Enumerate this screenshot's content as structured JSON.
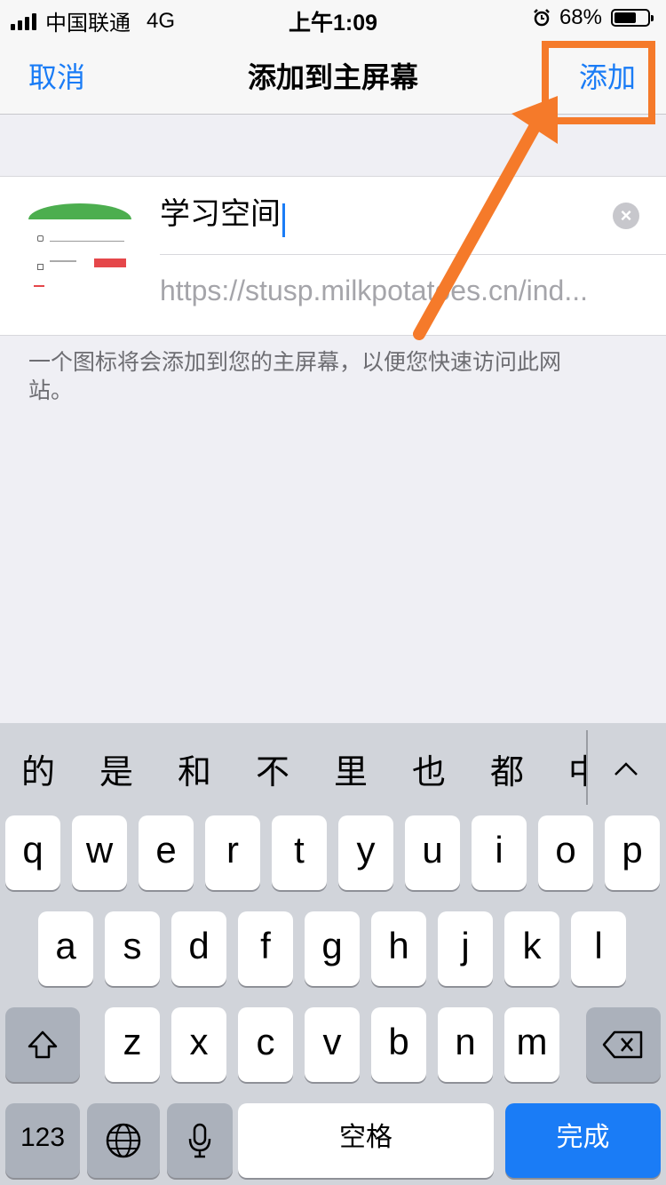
{
  "status_bar": {
    "carrier": "中国联通",
    "network": "4G",
    "time": "上午1:09",
    "battery": "68%",
    "battery_level": 0.68
  },
  "nav": {
    "cancel_label": "取消",
    "title": "添加到主屏幕",
    "add_label": "添加"
  },
  "shortcut": {
    "name_value": "学习空间",
    "url": "https://stusp.milkpotatoes.cn/ind..."
  },
  "hint": "一个图标将会添加到您的主屏幕，以便您快速访问此网站。",
  "colors": {
    "accent": "#1a7cf6",
    "annotation": "#f57a2a"
  },
  "keyboard": {
    "candidates": [
      "的",
      "是",
      "和",
      "不",
      "里",
      "也",
      "都",
      "中"
    ],
    "row1": [
      "q",
      "w",
      "e",
      "r",
      "t",
      "y",
      "u",
      "i",
      "o",
      "p"
    ],
    "row2": [
      "a",
      "s",
      "d",
      "f",
      "g",
      "h",
      "j",
      "k",
      "l"
    ],
    "row3": [
      "z",
      "x",
      "c",
      "v",
      "b",
      "n",
      "m"
    ],
    "numbers_label": "123",
    "space_label": "空格",
    "done_label": "完成",
    "icons": {
      "shift": "shift-icon",
      "delete": "delete-icon",
      "globe": "globe-icon",
      "mic": "microphone-icon",
      "collapse": "chevron-up-icon"
    }
  }
}
